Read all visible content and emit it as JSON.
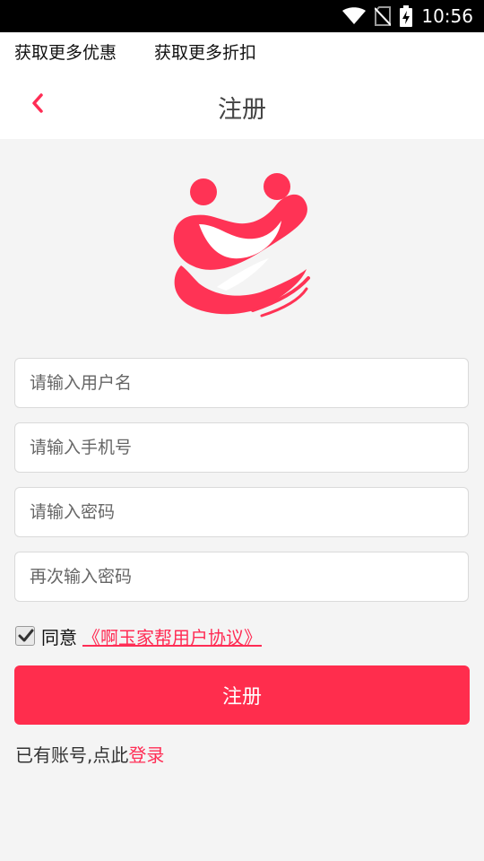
{
  "status_bar": {
    "time": "10:56",
    "icons": [
      "wifi-icon",
      "no-sim-icon",
      "battery-charging-icon"
    ]
  },
  "promo": {
    "link1": "获取更多优惠",
    "link2": "获取更多折扣"
  },
  "header": {
    "title": "注册",
    "back_icon": "chevron-left-icon"
  },
  "colors": {
    "accent": "#ff2d4d",
    "link": "#ff2d55"
  },
  "form": {
    "username_placeholder": "请输入用户名",
    "phone_placeholder": "请输入手机号",
    "password_placeholder": "请输入密码",
    "confirm_placeholder": "再次输入密码",
    "agree_label": "同意",
    "agreement_link": "《啊玉家帮用户协议》",
    "agree_checked": true,
    "submit_label": "注册"
  },
  "footer": {
    "prompt": "已有账号,点此",
    "login_link": "登录"
  }
}
